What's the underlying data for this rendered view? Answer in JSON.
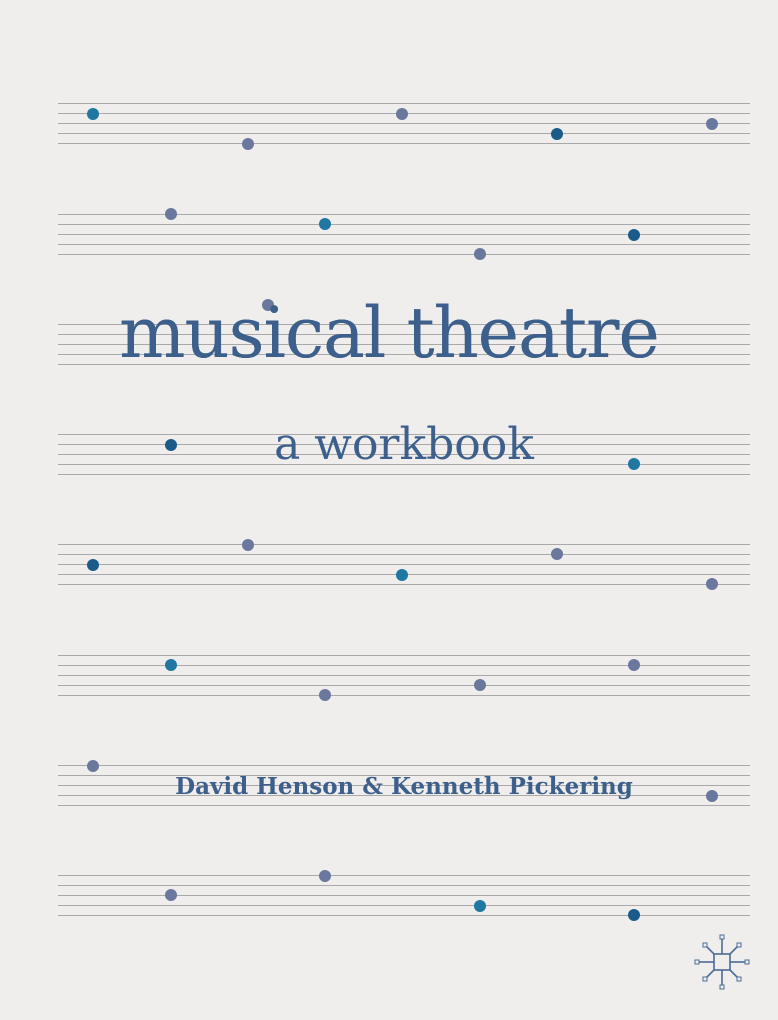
{
  "cover": {
    "title": "musical theatre",
    "subtitle": "a workbook",
    "authors": "David Henson & Kenneth Pickering",
    "publisher_logo_icon": "palgrave-macmillan-logo-icon"
  },
  "colors": {
    "background": "#efeeec",
    "text": "#3c5f8c",
    "staff_lines": "#a9a9a9",
    "note_teal": "#1f77a2",
    "note_slate": "#6a789e",
    "note_navy": "#1a5b8a"
  }
}
